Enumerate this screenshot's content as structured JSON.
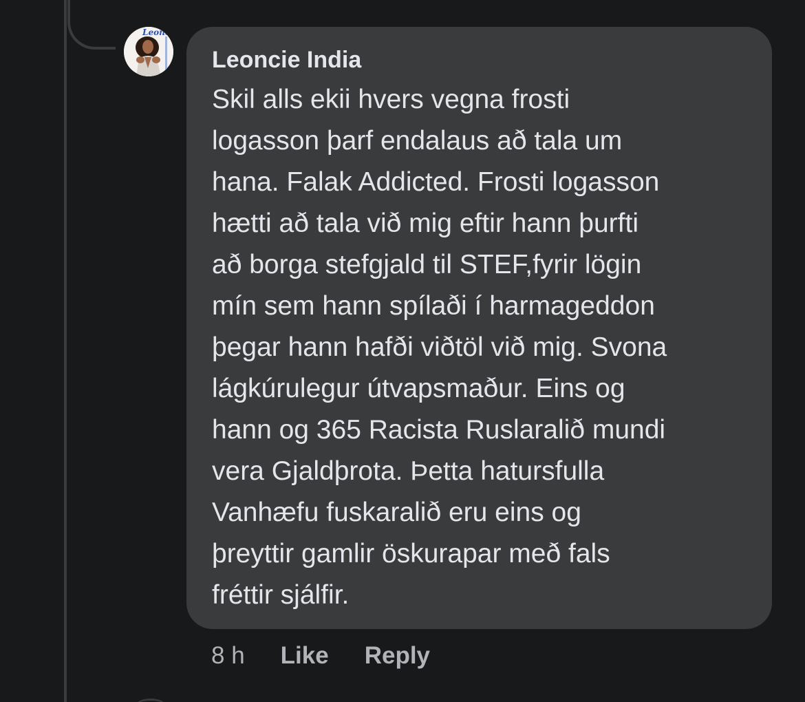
{
  "comment": {
    "author": "Leoncie India",
    "avatar_icon": "profile-photo-avatar",
    "avatar_logo_text": "Leoncie",
    "text_lines": [
      "Skil alls ekii hvers vegna frosti",
      "logasson þarf endalaus að tala um",
      "hana. Falak Addicted. Frosti logasson",
      "hætti að tala við mig eftir hann þurfti",
      "að borga stefgjald til STEF,fyrir lögin",
      "mín sem hann spílaði í harmageddon",
      "þegar hann hafði viðtöl við mig. Svona",
      "lágkúrulegur útvapsmaður. Eins og",
      "hann og 365 Racista Ruslaralið mundi",
      "vera Gjaldþrota. Þetta hatursfulla",
      "Vanhæfu fuskaralið eru eins og",
      "þreyttir gamlir öskurapar með fals",
      "fréttir sjálfir."
    ],
    "timestamp": "8 h",
    "like_label": "Like",
    "reply_label": "Reply"
  },
  "colors": {
    "background": "#18191a",
    "bubble": "#3a3b3c",
    "primary_text": "#e4e6eb",
    "secondary_text": "#b0b3b8"
  }
}
